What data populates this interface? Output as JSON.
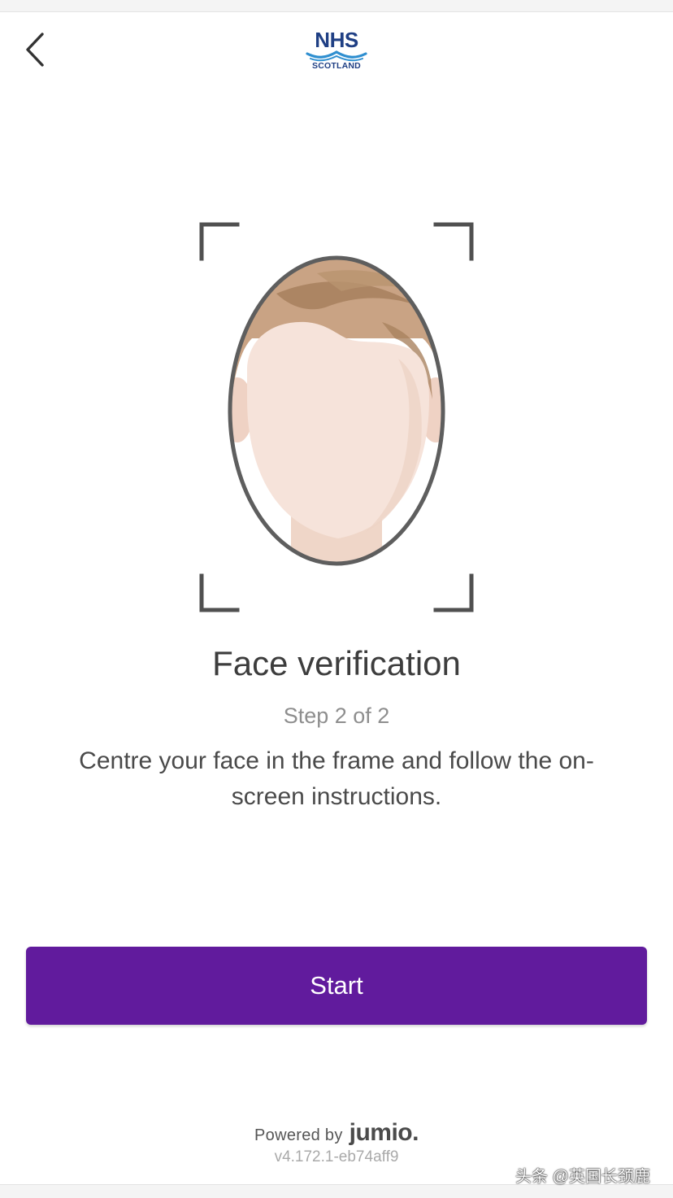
{
  "header": {
    "back_icon": "chevron-left-icon",
    "logo": {
      "line1": "NHS",
      "line2": "SCOTLAND"
    }
  },
  "illustration": {
    "icon": "face-oval-frame-icon"
  },
  "content": {
    "title": "Face verification",
    "step": "Step 2 of 2",
    "instructions": "Centre your face in the frame and follow the on-screen instructions."
  },
  "actions": {
    "start_label": "Start"
  },
  "footer": {
    "powered_label": "Powered by",
    "powered_brand": "jumio.",
    "version": "v4.172.1-eb74aff9"
  },
  "watermark": "头条 @英国长颈鹿",
  "colors": {
    "accent": "#611b9d",
    "logo": "#1f3f84",
    "text": "#3d3d3d",
    "muted": "#8e8e8e"
  }
}
